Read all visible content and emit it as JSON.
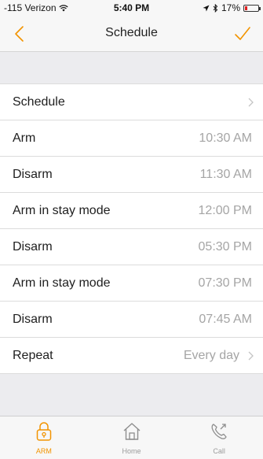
{
  "status_bar": {
    "carrier": "-115 Verizon",
    "time": "5:40 PM",
    "battery": "17%",
    "battery_level": 0.17,
    "battery_color": "#e02020"
  },
  "nav": {
    "title": "Schedule",
    "back_icon": "chevron-left-icon",
    "done_icon": "checkmark-icon",
    "accent_color": "#f29400"
  },
  "schedule_header": {
    "label": "Schedule"
  },
  "events": [
    {
      "label": "Arm",
      "time": "10:30 AM"
    },
    {
      "label": "Disarm",
      "time": "11:30 AM"
    },
    {
      "label": "Arm in stay mode",
      "time": "12:00 PM"
    },
    {
      "label": "Disarm",
      "time": "05:30 PM"
    },
    {
      "label": "Arm in stay mode",
      "time": "07:30 PM"
    },
    {
      "label": "Disarm",
      "time": "07:45 AM"
    }
  ],
  "repeat": {
    "label": "Repeat",
    "value": "Every day"
  },
  "tabs": [
    {
      "label": "ARM",
      "icon": "lock-icon",
      "active": true
    },
    {
      "label": "Home",
      "icon": "home-icon",
      "active": false
    },
    {
      "label": "Call",
      "icon": "phone-icon",
      "active": false
    }
  ]
}
